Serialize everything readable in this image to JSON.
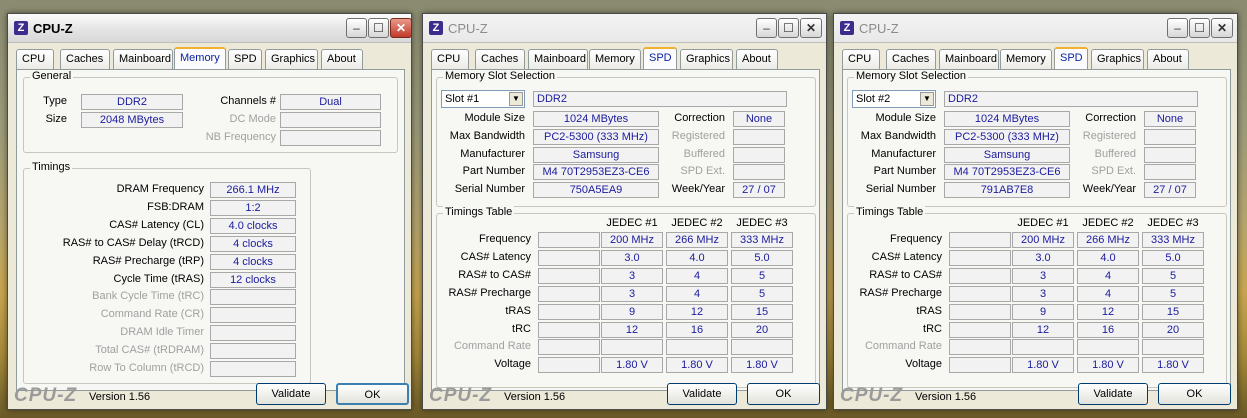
{
  "app_title": "CPU-Z",
  "app_icon_letter": "Z",
  "tabs": [
    "CPU",
    "Caches",
    "Mainboard",
    "Memory",
    "SPD",
    "Graphics",
    "About"
  ],
  "footer": {
    "logo": "CPU-Z",
    "version": "Version 1.56",
    "validate": "Validate",
    "ok": "OK"
  },
  "memory": {
    "general_title": "General",
    "type_label": "Type",
    "type_value": "DDR2",
    "size_label": "Size",
    "size_value": "2048 MBytes",
    "channels_label": "Channels #",
    "channels_value": "Dual",
    "dcmode_label": "DC Mode",
    "dcmode_value": "",
    "nbfreq_label": "NB Frequency",
    "nbfreq_value": "",
    "timings_title": "Timings",
    "timings": [
      {
        "label": "DRAM Frequency",
        "value": "266.1 MHz",
        "disabled": false
      },
      {
        "label": "FSB:DRAM",
        "value": "1:2",
        "disabled": false
      },
      {
        "label": "CAS# Latency (CL)",
        "value": "4.0 clocks",
        "disabled": false
      },
      {
        "label": "RAS# to CAS# Delay (tRCD)",
        "value": "4 clocks",
        "disabled": false
      },
      {
        "label": "RAS# Precharge (tRP)",
        "value": "4 clocks",
        "disabled": false
      },
      {
        "label": "Cycle Time (tRAS)",
        "value": "12 clocks",
        "disabled": false
      },
      {
        "label": "Bank Cycle Time (tRC)",
        "value": "",
        "disabled": true
      },
      {
        "label": "Command Rate (CR)",
        "value": "",
        "disabled": true
      },
      {
        "label": "DRAM Idle Timer",
        "value": "",
        "disabled": true
      },
      {
        "label": "Total CAS# (tRDRAM)",
        "value": "",
        "disabled": true
      },
      {
        "label": "Row To Column (tRCD)",
        "value": "",
        "disabled": true
      }
    ]
  },
  "spd_labels": {
    "slot_group": "Memory Slot Selection",
    "module_size": "Module Size",
    "max_bandwidth": "Max Bandwidth",
    "manufacturer": "Manufacturer",
    "part_number": "Part Number",
    "serial_number": "Serial Number",
    "correction": "Correction",
    "registered": "Registered",
    "buffered": "Buffered",
    "spd_ext": "SPD Ext.",
    "week_year": "Week/Year",
    "timings_table": "Timings Table",
    "col1": "JEDEC #1",
    "col2": "JEDEC #2",
    "col3": "JEDEC #3",
    "rows": [
      "Frequency",
      "CAS# Latency",
      "RAS# to CAS#",
      "RAS# Precharge",
      "tRAS",
      "tRC",
      "Command Rate",
      "Voltage"
    ]
  },
  "spd": [
    {
      "slot": "Slot #1",
      "type": "DDR2",
      "module_size": "1024 MBytes",
      "max_bandwidth": "PC2-5300 (333 MHz)",
      "manufacturer": "Samsung",
      "part_number": "M4 70T2953EZ3-CE6",
      "serial_number": "750A5EA9",
      "correction": "None",
      "week_year": "27 / 07",
      "table": [
        [
          "200 MHz",
          "266 MHz",
          "333 MHz"
        ],
        [
          "3.0",
          "4.0",
          "5.0"
        ],
        [
          "3",
          "4",
          "5"
        ],
        [
          "3",
          "4",
          "5"
        ],
        [
          "9",
          "12",
          "15"
        ],
        [
          "12",
          "16",
          "20"
        ],
        [
          "",
          "",
          ""
        ],
        [
          "1.80 V",
          "1.80 V",
          "1.80 V"
        ]
      ]
    },
    {
      "slot": "Slot #2",
      "type": "DDR2",
      "module_size": "1024 MBytes",
      "max_bandwidth": "PC2-5300 (333 MHz)",
      "manufacturer": "Samsung",
      "part_number": "M4 70T2953EZ3-CE6",
      "serial_number": "791AB7E8",
      "correction": "None",
      "week_year": "27 / 07",
      "table": [
        [
          "200 MHz",
          "266 MHz",
          "333 MHz"
        ],
        [
          "3.0",
          "4.0",
          "5.0"
        ],
        [
          "3",
          "4",
          "5"
        ],
        [
          "3",
          "4",
          "5"
        ],
        [
          "9",
          "12",
          "15"
        ],
        [
          "12",
          "16",
          "20"
        ],
        [
          "",
          "",
          ""
        ],
        [
          "1.80 V",
          "1.80 V",
          "1.80 V"
        ]
      ]
    }
  ]
}
